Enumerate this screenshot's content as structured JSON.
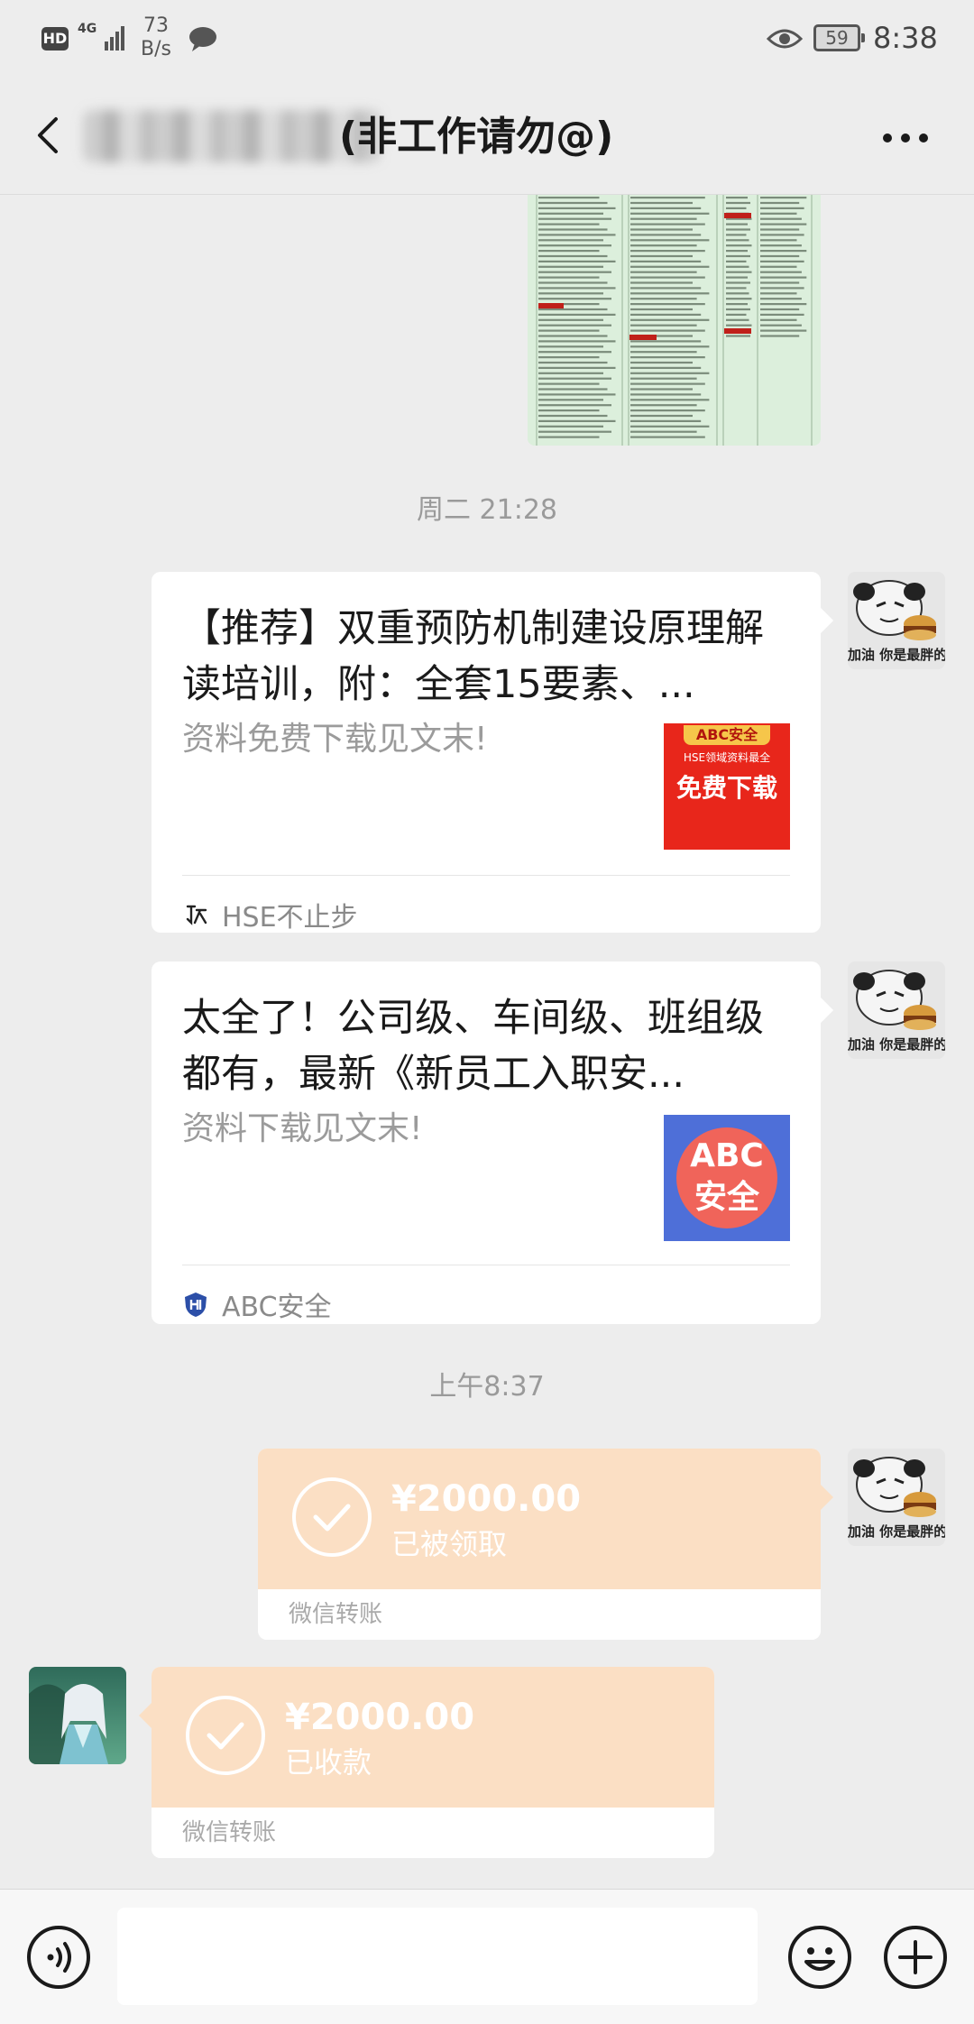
{
  "status_bar": {
    "hd_badge": "HD",
    "network": "4G",
    "net_speed_value": "73",
    "net_speed_unit": "B/s",
    "battery": "59",
    "time": "8:38",
    "icons": [
      "hd-icon",
      "signal-icon",
      "message-icon",
      "eye-icon",
      "battery-icon"
    ]
  },
  "header": {
    "chat_title": "(非工作请勿@)",
    "icons": [
      "back-icon",
      "more-icon"
    ]
  },
  "messages": {
    "timestamp_1": "周二 21:28",
    "article_1": {
      "title": "【推荐】双重预防机制建设原理解读培训，附：全套15要素、...",
      "description": "资料免费下载见文末!",
      "thumb_tag": "ABC安全",
      "thumb_sub": "HSE领域资料最全",
      "thumb_main": "免费下载",
      "source": "HSE不止步"
    },
    "article_2": {
      "title": "太全了！公司级、车间级、班组级都有，最新《新员工入职安...",
      "description": "资料下载见文末!",
      "thumb_line1": "ABC",
      "thumb_line2": "安全",
      "source": "ABC安全"
    },
    "timestamp_2": "上午8:37",
    "transfer_sent": {
      "amount": "¥2000.00",
      "status": "已被领取",
      "label": "微信转账"
    },
    "transfer_received": {
      "amount": "¥2000.00",
      "status": "已收款",
      "label": "微信转账"
    }
  },
  "avatars": {
    "self_caption": "加油 你是最胖的"
  },
  "colors": {
    "background": "#ededed",
    "transfer": "#fbdfc4",
    "card": "#ffffff",
    "timestamp": "#9a9a9a"
  }
}
